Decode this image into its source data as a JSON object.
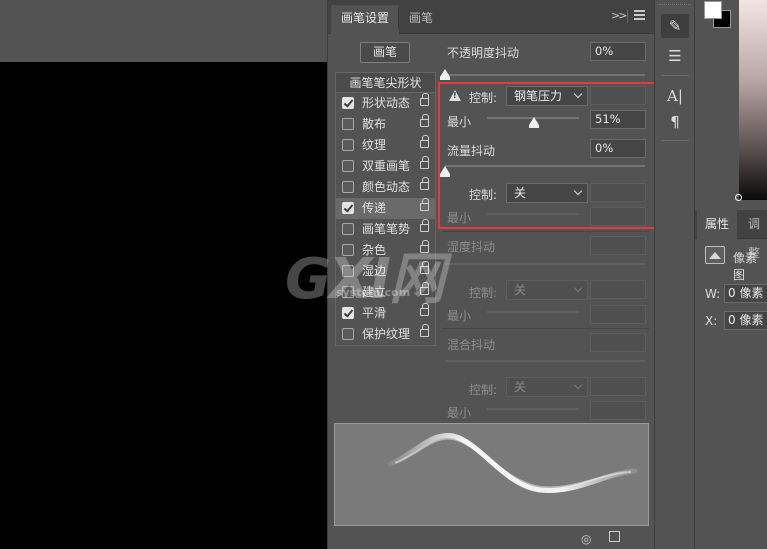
{
  "brush_panel": {
    "tabs": [
      {
        "label": "画笔设置",
        "active": true
      },
      {
        "label": "画笔",
        "active": false
      }
    ],
    "preset_button": "画笔",
    "tip_shape_header": "画笔笔尖形状",
    "options": [
      {
        "label": "形状动态",
        "checked": true,
        "selected": false
      },
      {
        "label": "散布",
        "checked": false,
        "selected": false
      },
      {
        "label": "纹理",
        "checked": false,
        "selected": false
      },
      {
        "label": "双重画笔",
        "checked": false,
        "selected": false
      },
      {
        "label": "颜色动态",
        "checked": false,
        "selected": false
      },
      {
        "label": "传递",
        "checked": true,
        "selected": true
      },
      {
        "label": "画笔笔势",
        "checked": false,
        "selected": false
      },
      {
        "label": "杂色",
        "checked": false,
        "selected": false
      },
      {
        "label": "湿边",
        "checked": false,
        "selected": false
      },
      {
        "label": "建立",
        "checked": false,
        "selected": false
      },
      {
        "label": "平滑",
        "checked": true,
        "selected": false
      },
      {
        "label": "保护纹理",
        "checked": false,
        "selected": false
      }
    ],
    "opacity_jitter": {
      "label": "不透明度抖动",
      "value": "0%",
      "slider": 0
    },
    "control_1": {
      "label": "控制:",
      "selected": "钢笔压力"
    },
    "minimum_1": {
      "label": "最小",
      "value": "51%",
      "slider": 0.51
    },
    "flow_jitter": {
      "label": "流量抖动",
      "value": "0%",
      "slider": 0
    },
    "control_2": {
      "label": "控制:",
      "selected": "关"
    },
    "minimum_2": {
      "label": "最小",
      "value": ""
    },
    "wetness_jitter": {
      "label": "湿度抖动",
      "value": ""
    },
    "control_3": {
      "label": "控制:",
      "selected": "关"
    },
    "minimum_3": {
      "label": "最小",
      "value": ""
    },
    "mix_jitter": {
      "label": "混合抖动",
      "value": ""
    },
    "control_4": {
      "label": "控制:",
      "selected": "关"
    },
    "minimum_4": {
      "label": "最小",
      "value": ""
    },
    "highlight_color": "#e23c3c"
  },
  "watermark": {
    "main": "GXI网",
    "sub": "system.com"
  },
  "toolbar_icons": [
    "brush-settings-icon",
    "brush-presets-icon",
    "character-icon",
    "paragraph-icon"
  ],
  "properties_panel": {
    "tabs": [
      {
        "label": "属性",
        "active": true
      },
      {
        "label": "调整",
        "active": false
      }
    ],
    "layer_type": "像素图",
    "w_label": "W:",
    "w_value": "0 像素",
    "x_label": "X:",
    "x_value": "0 像素"
  }
}
